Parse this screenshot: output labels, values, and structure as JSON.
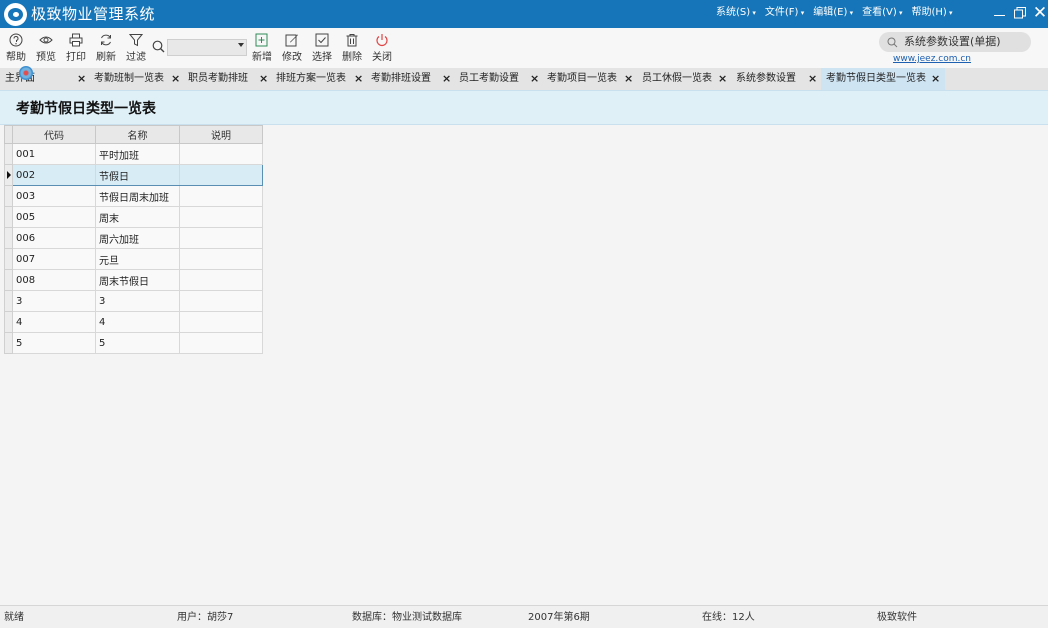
{
  "app": {
    "title": "极致物业管理系统"
  },
  "menu": [
    {
      "label": "系统(S)"
    },
    {
      "label": "文件(F)"
    },
    {
      "label": "编辑(E)"
    },
    {
      "label": "查看(V)"
    },
    {
      "label": "帮助(H)"
    }
  ],
  "toolbar": {
    "help": "帮助",
    "preview": "预览",
    "print": "打印",
    "refresh": "刷新",
    "filter": "过滤",
    "search_value": "",
    "add": "新增",
    "edit": "修改",
    "select": "选择",
    "delete": "删除",
    "close": "关闭"
  },
  "quick": {
    "label": "系统参数设置(单据)",
    "link": "www.jeez.com.cn"
  },
  "tabs": [
    {
      "label": "主界面"
    },
    {
      "label": "考勤班制一览表"
    },
    {
      "label": "职员考勤排班"
    },
    {
      "label": "排班方案一览表"
    },
    {
      "label": "考勤排班设置"
    },
    {
      "label": "员工考勤设置"
    },
    {
      "label": "考勤项目一览表"
    },
    {
      "label": "员工休假一览表"
    },
    {
      "label": "系统参数设置"
    },
    {
      "label": "考勤节假日类型一览表"
    }
  ],
  "page": {
    "title": "考勤节假日类型一览表"
  },
  "table": {
    "columns": [
      "代码",
      "名称",
      "说明"
    ],
    "rows": [
      {
        "code": "001",
        "name": "平时加班",
        "desc": ""
      },
      {
        "code": "002",
        "name": "节假日",
        "desc": ""
      },
      {
        "code": "003",
        "name": "节假日周末加班",
        "desc": ""
      },
      {
        "code": "005",
        "name": "周末",
        "desc": ""
      },
      {
        "code": "006",
        "name": "周六加班",
        "desc": ""
      },
      {
        "code": "007",
        "name": "元旦",
        "desc": ""
      },
      {
        "code": "008",
        "name": "周末节假日",
        "desc": ""
      },
      {
        "code": "3",
        "name": "3",
        "desc": ""
      },
      {
        "code": "4",
        "name": "4",
        "desc": ""
      },
      {
        "code": "5",
        "name": "5",
        "desc": ""
      }
    ],
    "selected_index": 1
  },
  "status": {
    "state": "就绪",
    "user": "用户：胡莎7",
    "database": "数据库：物业测试数据库",
    "period": "2007年第6期",
    "online": "在线：12人",
    "vendor": "极致软件"
  },
  "colors": {
    "title_bar": "#1675b8",
    "page_header": "#dff0f7",
    "selected_row": "#d8ecf6",
    "active_tab": "#cfe4f3"
  }
}
